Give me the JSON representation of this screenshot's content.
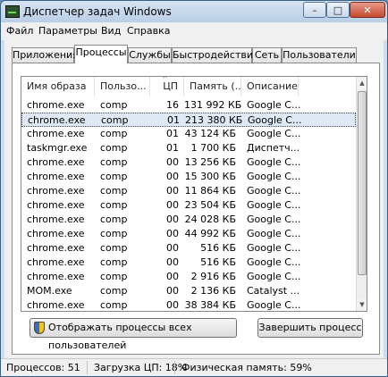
{
  "window": {
    "title": "Диспетчер задач Windows",
    "min_glyph": "–",
    "max_glyph": "□",
    "close_glyph": "✕"
  },
  "menu": [
    "Файл",
    "Параметры",
    "Вид",
    "Справка"
  ],
  "tabs": [
    "Приложения",
    "Процессы",
    "Службы",
    "Быстродействие",
    "Сеть",
    "Пользователи"
  ],
  "active_tab": "Процессы",
  "columns": [
    "Имя образа",
    "Пользо...",
    "ЦП",
    "Память (...",
    "Описание"
  ],
  "sort_caret": "^",
  "processes": [
    {
      "name": "chrome.exe",
      "user": "comp",
      "cpu": "16",
      "mem": "131 992 КБ",
      "desc": "Google C..."
    },
    {
      "name": "chrome.exe",
      "user": "comp",
      "cpu": "01",
      "mem": "213 380 КБ",
      "desc": "Google C..."
    },
    {
      "name": "chrome.exe",
      "user": "comp",
      "cpu": "01",
      "mem": "43 124 КБ",
      "desc": "Google C..."
    },
    {
      "name": "taskmgr.exe",
      "user": "comp",
      "cpu": "01",
      "mem": "1 700 КБ",
      "desc": "Диспетч..."
    },
    {
      "name": "chrome.exe",
      "user": "comp",
      "cpu": "00",
      "mem": "13 256 КБ",
      "desc": "Google C..."
    },
    {
      "name": "chrome.exe",
      "user": "comp",
      "cpu": "00",
      "mem": "15 300 КБ",
      "desc": "Google C..."
    },
    {
      "name": "chrome.exe",
      "user": "comp",
      "cpu": "00",
      "mem": "11 864 КБ",
      "desc": "Google C..."
    },
    {
      "name": "chrome.exe",
      "user": "comp",
      "cpu": "00",
      "mem": "23 504 КБ",
      "desc": "Google C..."
    },
    {
      "name": "chrome.exe",
      "user": "comp",
      "cpu": "00",
      "mem": "24 028 КБ",
      "desc": "Google C..."
    },
    {
      "name": "chrome.exe",
      "user": "comp",
      "cpu": "00",
      "mem": "44 992 КБ",
      "desc": "Google C..."
    },
    {
      "name": "chrome.exe",
      "user": "comp",
      "cpu": "00",
      "mem": "516 КБ",
      "desc": "Google C..."
    },
    {
      "name": "chrome.exe",
      "user": "comp",
      "cpu": "00",
      "mem": "516 КБ",
      "desc": "Google C..."
    },
    {
      "name": "chrome.exe",
      "user": "comp",
      "cpu": "00",
      "mem": "2 916 КБ",
      "desc": "Google C..."
    },
    {
      "name": "MOM.exe",
      "user": "comp",
      "cpu": "00",
      "mem": "2 136 КБ",
      "desc": "Catalyst ..."
    },
    {
      "name": "chrome.exe",
      "user": "comp",
      "cpu": "00",
      "mem": "38 384 КБ",
      "desc": "Google C..."
    }
  ],
  "selected_row": 1,
  "buttons": {
    "show_all_users": "Отображать процессы всех пользователей",
    "end_process": "Завершить процесс"
  },
  "status": {
    "processes": "Процессов: 51",
    "cpu": "Загрузка ЦП: 18%",
    "memory": "Физическая память: 59%"
  },
  "scrollbar": {
    "up_glyph": "▲",
    "down_glyph": "▼"
  }
}
